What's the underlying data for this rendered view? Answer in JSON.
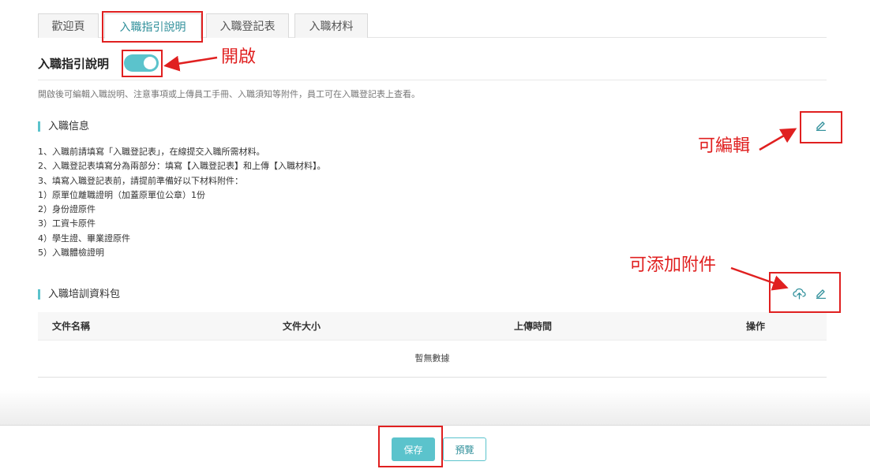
{
  "tabs": [
    {
      "label": "歡迎頁",
      "active": false
    },
    {
      "label": "入職指引說明",
      "active": true
    },
    {
      "label": "入職登記表",
      "active": false
    },
    {
      "label": "入職材料",
      "active": false
    }
  ],
  "guide": {
    "title": "入職指引說明",
    "toggle_on": true,
    "description": "開啟後可編輯入職說明、注意事項或上傳員工手冊、入職須知等附件，員工可在入職登記表上查看。"
  },
  "info": {
    "heading": "入職信息",
    "lines": [
      "1、入職前請填寫「入職登記表」，在線提交入職所需材料。",
      "2、入職登記表填寫分為兩部分：填寫【入職登記表】和上傳【入職材料】。",
      "3、填寫入職登記表前，請提前準備好以下材料附件：",
      "1）原單位離職證明（加蓋原單位公章）1份",
      "2）身份證原件",
      "3）工資卡原件",
      "4）學生證、畢業證原件",
      "5）入職體檢證明"
    ]
  },
  "training": {
    "heading": "入職培訓資料包",
    "columns": [
      "文件名稱",
      "文件大小",
      "上傳時間",
      "操作"
    ],
    "empty_text": "暫無數據"
  },
  "footer": {
    "save_label": "保存",
    "preview_label": "預覽"
  },
  "annotations": {
    "toggle_note": "開啟",
    "edit_note": "可編輯",
    "attach_note": "可添加附件",
    "color": "#e02020"
  },
  "colors": {
    "accent": "#5bc3cc",
    "accent_text": "#2f8f9a"
  }
}
